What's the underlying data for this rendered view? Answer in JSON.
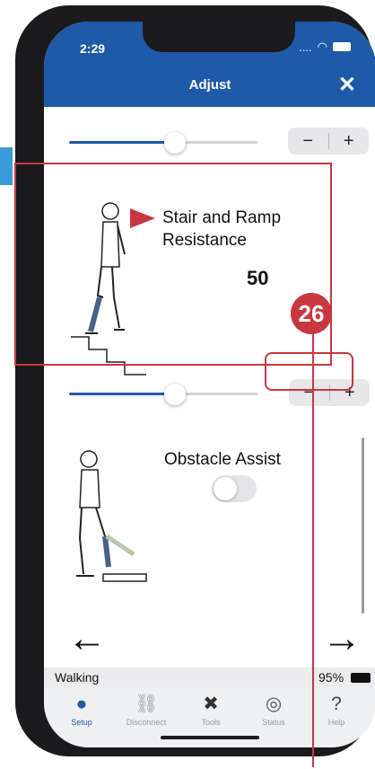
{
  "device": {
    "time": "2:29",
    "signal": "...."
  },
  "header": {
    "title": "Adjust",
    "close_symbol": "✕"
  },
  "top_slider": {
    "level_fraction": 0.5
  },
  "stair_ramp": {
    "label": "Stair and Ramp Resistance",
    "value": "50",
    "slider_level_fraction": 0.5
  },
  "stepper": {
    "minus": "−",
    "plus": "+"
  },
  "callout": {
    "number": "26"
  },
  "obstacle": {
    "label": "Obstacle Assist",
    "enabled": false
  },
  "nav": {
    "back": "←",
    "forward": "→"
  },
  "statusbar": {
    "mode": "Walking",
    "battery": "95%"
  },
  "tabbar": {
    "items": [
      {
        "label": "Setup",
        "icon": "user-gear-icon",
        "active": true
      },
      {
        "label": "Disconnect",
        "icon": "link-broken-icon",
        "active": false
      },
      {
        "label": "Tools",
        "icon": "tools-icon",
        "active": false
      },
      {
        "label": "Status",
        "icon": "status-icon",
        "active": false
      },
      {
        "label": "Help",
        "icon": "help-icon",
        "active": false
      }
    ]
  },
  "colors": {
    "header": "#1f5aa8",
    "accent": "#c9373f",
    "fill": "#1f5aa8"
  }
}
